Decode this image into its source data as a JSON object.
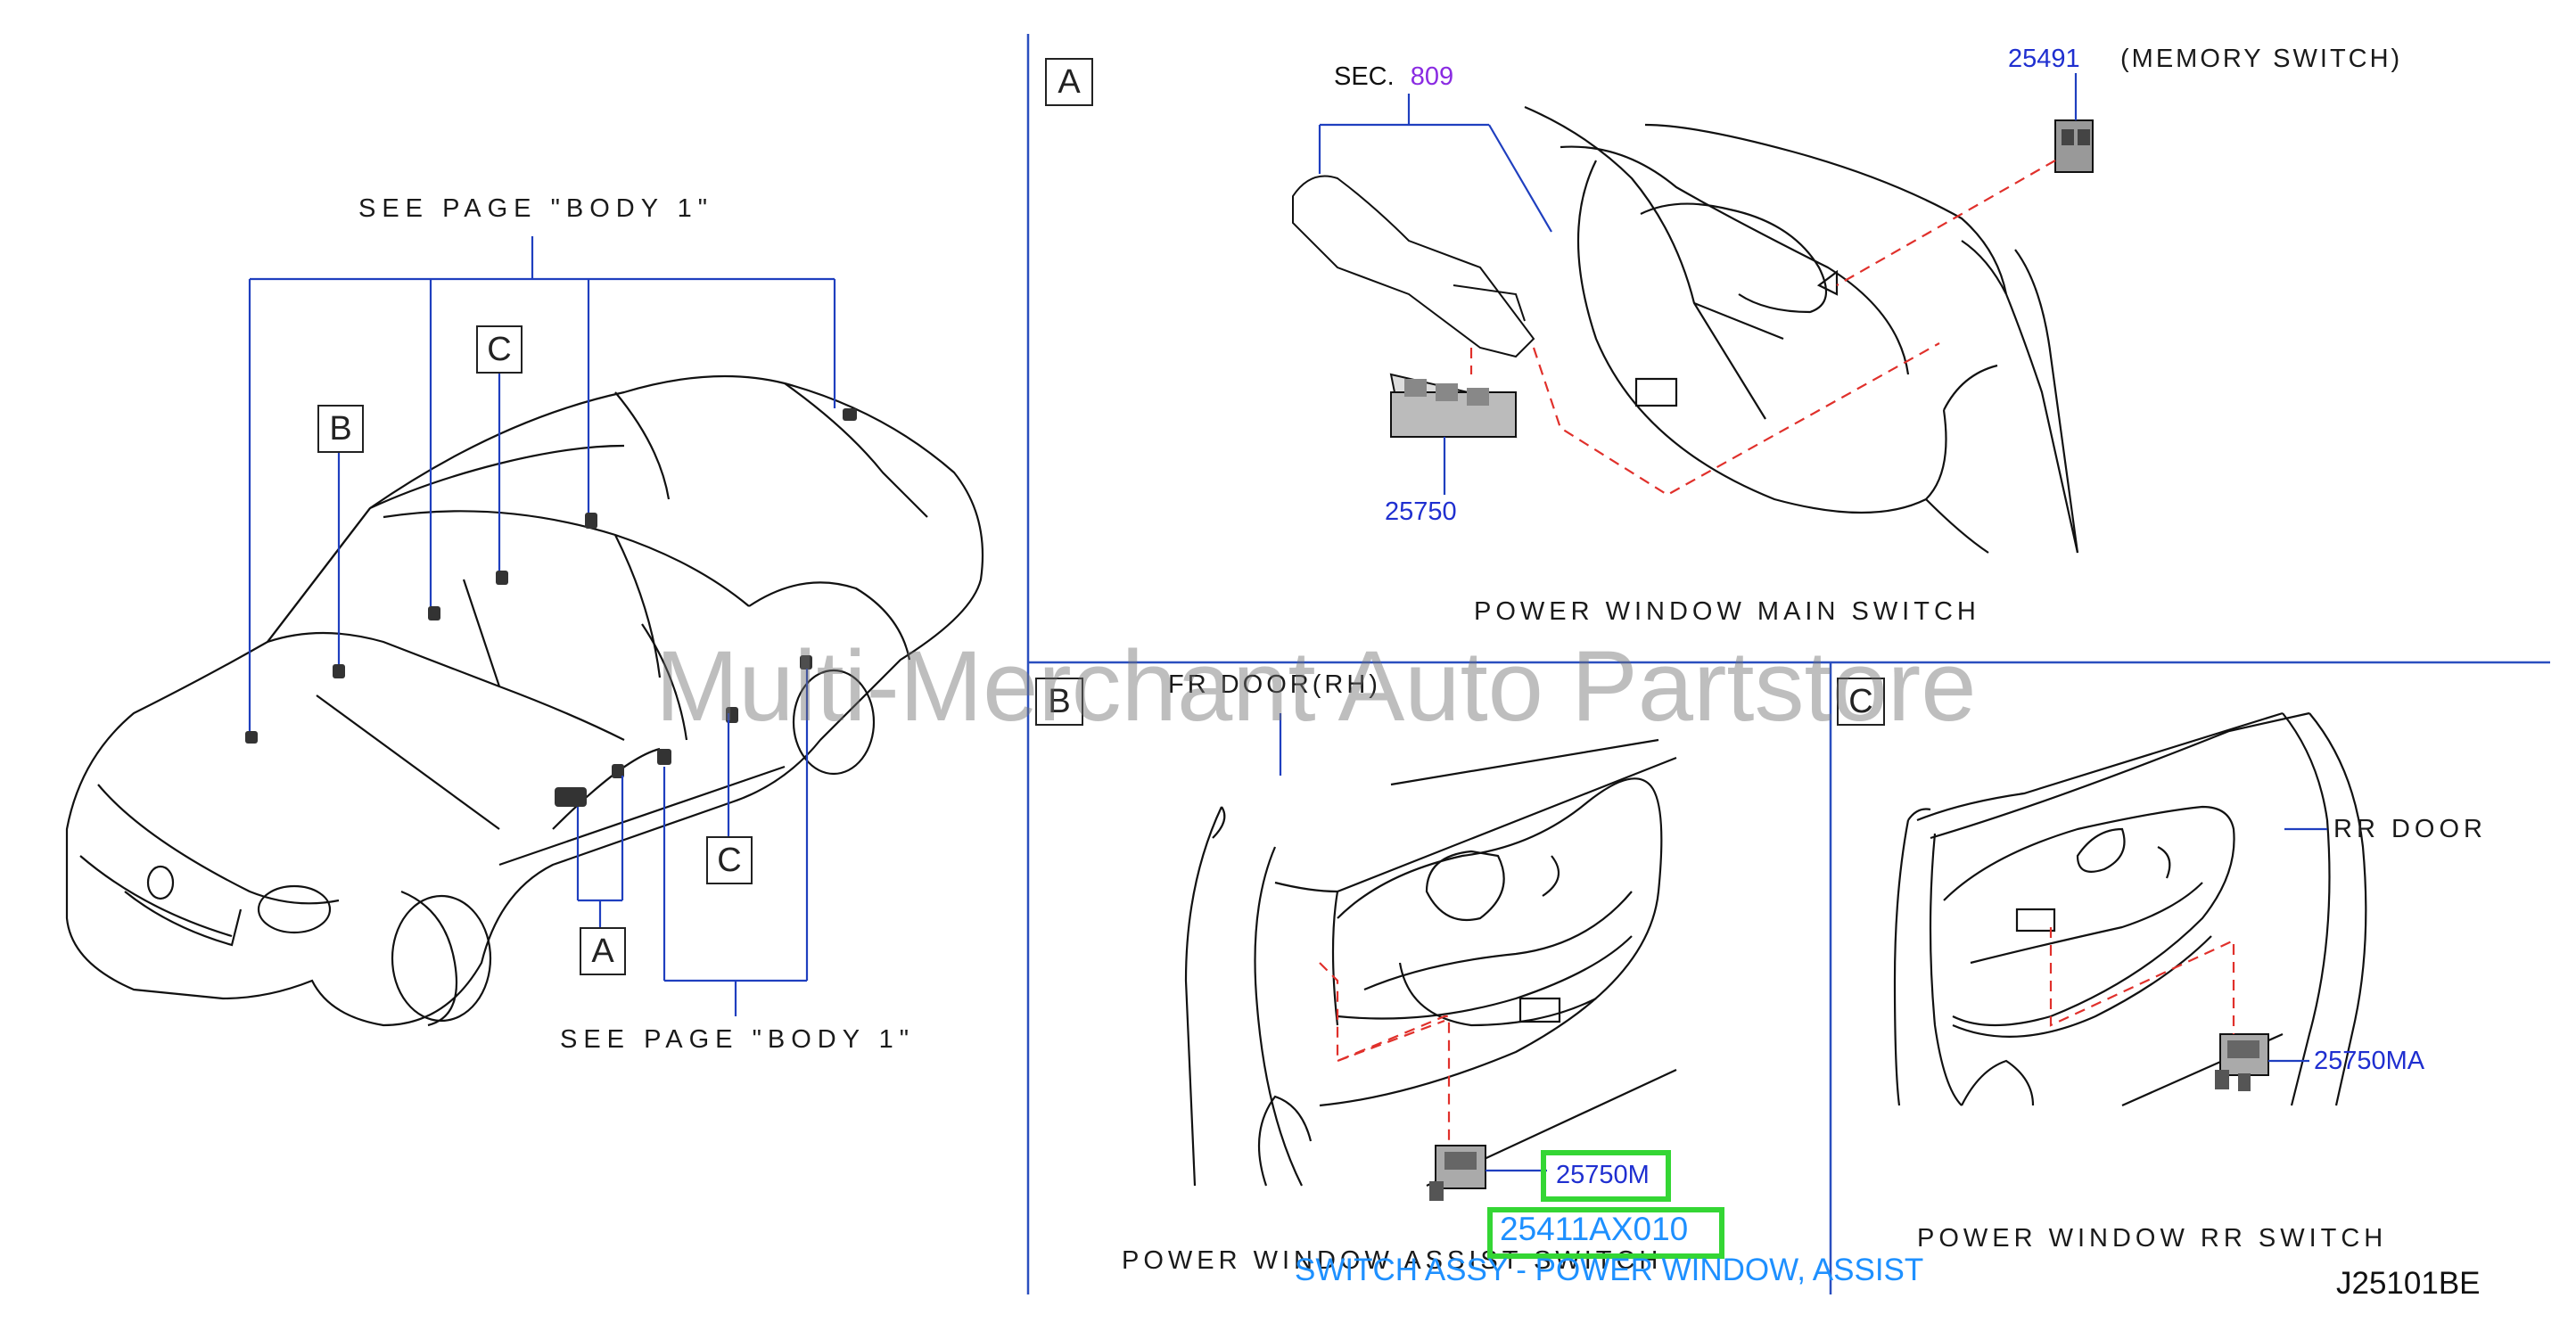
{
  "watermark": "Multi-Merchant Auto Partstore",
  "car_view": {
    "see_page_top": "SEE   PAGE   \"BODY   1\"",
    "see_page_bottom": "SEE   PAGE   \"BODY   1\"",
    "callouts": {
      "a": "A",
      "b": "B",
      "c1": "C",
      "c2": "C"
    }
  },
  "panel_a": {
    "label": "A",
    "sec_prefix": "SEC.",
    "sec_number": "809",
    "memory_part": "25491",
    "memory_desc": "(MEMORY   SWITCH)",
    "main_part": "25750",
    "title": "POWER   WINDOW   MAIN   SWITCH"
  },
  "panel_b": {
    "label": "B",
    "door": "FR   DOOR(RH)",
    "part": "25750M",
    "oem_part": "25411AX010",
    "oem_desc": "SWITCH ASSY - POWER WINDOW, ASSIST",
    "title": "POWER   WINDOW   ASSIST   SWITCH"
  },
  "panel_c": {
    "label": "C",
    "door": "RR   DOOR",
    "part": "25750MA",
    "title": "POWER   WINDOW   RR   SWITCH"
  },
  "diagram_code": "J25101BE",
  "colors": {
    "leader": "#1f3fbf",
    "dashed": "#e0302b",
    "highlight": "#34d634",
    "part_text": "#1f2fd0",
    "sec_number": "#8a2be2"
  }
}
